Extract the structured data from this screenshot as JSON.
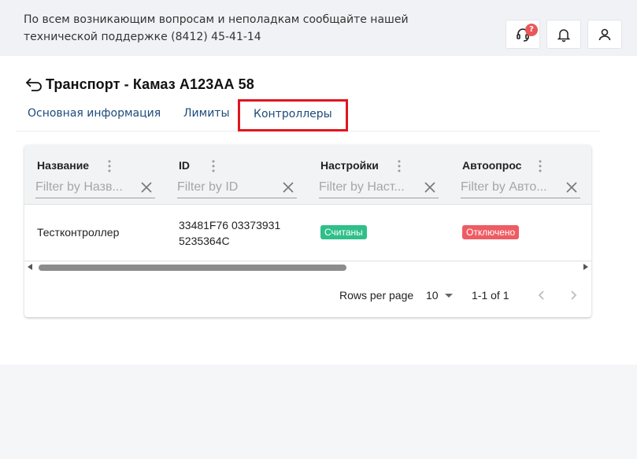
{
  "header": {
    "notice": "По всем возникающим вопросам и неполадкам сообщайте нашей технической поддержке (8412) 45-41-14",
    "support_badge": "?",
    "icons": [
      "headset-icon",
      "bell-icon",
      "user-icon"
    ]
  },
  "page": {
    "title": "Транспорт - Камаз А123АА 58"
  },
  "tabs": [
    {
      "label": "Основная информация"
    },
    {
      "label": "Лимиты"
    },
    {
      "label": "Контроллеры",
      "active": true
    }
  ],
  "table": {
    "columns": [
      {
        "title": "Название",
        "filter_placeholder": "Filter by Назв..."
      },
      {
        "title": "ID",
        "filter_placeholder": "Filter by ID"
      },
      {
        "title": "Настройки",
        "filter_placeholder": "Filter by Наст..."
      },
      {
        "title": "Автоопрос",
        "filter_placeholder": "Filter by Авто..."
      }
    ],
    "rows": [
      {
        "name": "Тестконтроллер",
        "id_line1": "33481F76 03373931",
        "id_line2": "5235364C",
        "settings": "Считаны",
        "autopoll": "Отключено"
      }
    ]
  },
  "pagination": {
    "rows_per_page_label": "Rows per page",
    "rows_per_page_value": "10",
    "range": "1-1 of 1"
  },
  "colors": {
    "accent_text": "#1d4a7a",
    "active_tab_border": "#e0161e",
    "chip_success": "#2fbf8a",
    "chip_danger": "#ee5c63",
    "badge": "#e8575a"
  }
}
